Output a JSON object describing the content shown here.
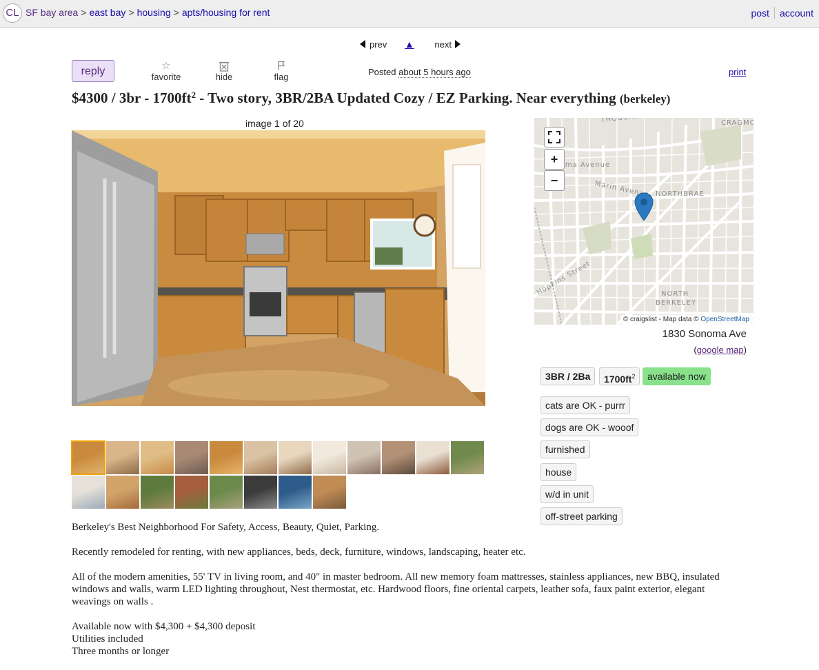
{
  "header": {
    "logo": "CL",
    "breadcrumbs": [
      "SF bay area",
      "east bay",
      "housing",
      "apts/housing for rent"
    ],
    "separator": ">",
    "links": {
      "post": "post",
      "account": "account"
    }
  },
  "nav": {
    "prev": "prev",
    "up": "▲",
    "next": "next"
  },
  "actions": {
    "reply": "reply",
    "favorite": "favorite",
    "hide": "hide",
    "flag": "flag",
    "posted_label": "Posted",
    "posted_time": "about 5 hours ago",
    "print": "print"
  },
  "listing": {
    "price": "$4300",
    "sep1": " / ",
    "br": "3br",
    "sep2": " - ",
    "area": "1700ft",
    "area_sup": "2",
    "title_text": " - Two story, 3BR/2BA Updated Cozy / EZ Parking. Near everything ",
    "location": "(berkeley)"
  },
  "gallery": {
    "counter": "image 1 of 20",
    "thumb_count": 20,
    "selected": 0
  },
  "map": {
    "labels": [
      "THOUSAND OAKS",
      "CRAGMO",
      "Sonoma Avenue",
      "Marin Avenue",
      "NORTHBRAE",
      "Hopkins Street",
      "NORTH",
      "BERKELEY"
    ],
    "attribution_prefix": "© craigslist - Map data © ",
    "attribution_link": "OpenStreetMap",
    "address": "1830 Sonoma Ave",
    "google_open": "(",
    "google_map": "google map",
    "google_close": ")"
  },
  "attributes": {
    "bed_bath": "3BR / 2Ba",
    "sqft": "1700ft",
    "sqft_sup": "2",
    "availability": "available now",
    "list": [
      "cats are OK - purrr",
      "dogs are OK - wooof",
      "furnished",
      "house",
      "w/d in unit",
      "off-street parking"
    ]
  },
  "colors": {
    "purple": "#5a2c80",
    "link": "#1a0dab",
    "available": "#89e28b",
    "reply_bg": "#eadff6"
  },
  "body": {
    "p1": "Berkeley's Best Neighborhood For Safety, Access, Beauty, Quiet, Parking.",
    "p2": "Recently remodeled for renting, with new appliances, beds, deck, furniture, windows, landscaping, heater etc.",
    "p3": "All of the modern amenities, 55' TV in living room, and 40\" in master bedroom. All new memory foam mattresses, stainless appliances, new BBQ, insulated windows and walls, warm LED lighting throughout, Nest thermostat, etc. Hardwood floors, fine oriental carpets, leather sofa, faux paint exterior, elegant weavings on walls .",
    "p4_lines": [
      "Available now with $4,300 + $4,300 deposit",
      "Utilities included",
      "Three months or longer"
    ]
  }
}
